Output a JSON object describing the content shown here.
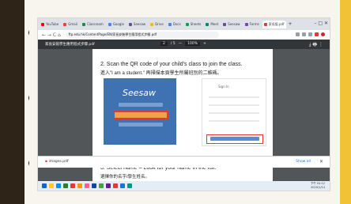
{
  "browser": {
    "tabs": [
      {
        "label": "YouTube",
        "color": "#ff0000"
      },
      {
        "label": "Gmail",
        "color": "#ea4335"
      },
      {
        "label": "Classroom",
        "color": "#1e8e3e"
      },
      {
        "label": "Google",
        "color": "#4285f4"
      },
      {
        "label": "Seesaw",
        "color": "#6a4c9c"
      },
      {
        "label": "Drive",
        "color": "#fbbc04"
      },
      {
        "label": "Docs",
        "color": "#4285f4"
      },
      {
        "label": "Sheets",
        "color": "#0f9d58"
      },
      {
        "label": "Meet",
        "color": "#00897b"
      },
      {
        "label": "Seesaw",
        "color": "#6a4c9c"
      },
      {
        "label": "Forms",
        "color": "#7248b9"
      },
      {
        "label": "家長版.pdf",
        "color": "#e53935",
        "active": true
      }
    ],
    "new_tab": "+",
    "controls": "–  □  ✕",
    "nav": "←  →  C  ⌂",
    "url": "ftp.edu.hk/ContentPage/EN/家長安裝學生應用程式步驟.pdf"
  },
  "pdf": {
    "filename": "家長安裝學生應用程式步驟.pdf",
    "page_current": "2",
    "page_total": "/ 5",
    "zoom": "100%",
    "actions": "⤓  🖶  ⋮"
  },
  "content": {
    "step2_title": "2. Scan the QR code of your child's class to join the class.",
    "step2_subtitle": "進入\"I am a student.\" 再掃描本頁學生所屬班別的二維碼。",
    "seesaw_logo": "Seesaw",
    "login_label": "Sign In",
    "step3_title": "3. Select name – Look for your name in the list.",
    "step3_subtitle": "選擇你的名字/學生姓名。"
  },
  "downloads": {
    "file": "images.pdf",
    "show_all": "Show all",
    "close": "✕"
  },
  "taskbar": {
    "icons": [
      "#1565c0",
      "#ffca28",
      "#1e88e5",
      "#2e7d32",
      "#e53935",
      "#ff9800",
      "#f06292",
      "#0d47a1",
      "#43a047",
      "#6a1b9a",
      "#e53935",
      "#1976d2",
      "#009688"
    ],
    "time": "下午 04:12",
    "date": "2020/1/14"
  }
}
